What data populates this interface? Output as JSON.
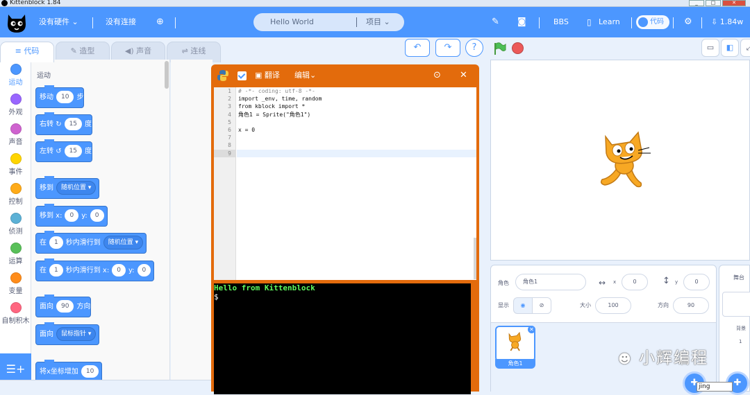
{
  "window": {
    "title": "Kittenblock 1.84"
  },
  "menubar": {
    "hardware": "没有硬件",
    "connection": "没有连接",
    "project_name": "Hello World",
    "project_menu": "项目",
    "bbs": "BBS",
    "learn": "Learn",
    "code_toggle": "代码",
    "version_badge": "1.84w"
  },
  "tabs": {
    "code": "代码",
    "costume": "造型",
    "sound": "声音",
    "connect": "连线"
  },
  "categories": [
    {
      "label": "运动",
      "color": "#4c97ff"
    },
    {
      "label": "外观",
      "color": "#9966ff"
    },
    {
      "label": "声音",
      "color": "#cf63cf"
    },
    {
      "label": "事件",
      "color": "#ffd500"
    },
    {
      "label": "控制",
      "color": "#ffab19"
    },
    {
      "label": "侦测",
      "color": "#5cb1d6"
    },
    {
      "label": "运算",
      "color": "#59c059"
    },
    {
      "label": "变量",
      "color": "#ff8c1a"
    },
    {
      "label": "自制积木",
      "color": "#ff6680"
    }
  ],
  "palette": {
    "title": "运动",
    "move": {
      "a": "移动",
      "n": "10",
      "b": "步"
    },
    "turn_right": {
      "a": "右转",
      "n": "15",
      "b": "度"
    },
    "turn_left": {
      "a": "左转",
      "n": "15",
      "b": "度"
    },
    "goto": {
      "a": "移到",
      "menu": "随机位置"
    },
    "goto_xy": {
      "a": "移到 x:",
      "x": "0",
      "b": "y:",
      "y": "0"
    },
    "glide": {
      "a": "在",
      "n": "1",
      "b": "秒内滑行到",
      "menu": "随机位置"
    },
    "glide_xy": {
      "a": "在",
      "n": "1",
      "b": "秒内滑行到 x:",
      "x": "0",
      "c": "y:",
      "y": "0"
    },
    "point_dir": {
      "a": "面向",
      "n": "90",
      "b": "方向"
    },
    "point_towards": {
      "a": "面向",
      "menu": "鼠标指针"
    },
    "change_x": {
      "a": "将x坐标增加",
      "n": "10"
    }
  },
  "editor": {
    "translate": "翻译",
    "edit": "编辑",
    "line_numbers": [
      "1",
      "2",
      "3",
      "4",
      "5",
      "6",
      "7",
      "8",
      "9"
    ],
    "code_lines": [
      "# -*- coding: utf-8 -*-",
      "import _env, time, random",
      "from kblock import *",
      "角色1 = Sprite(\"角色1\")",
      "",
      "x = 0",
      "",
      "",
      ""
    ],
    "terminal": {
      "line1": "Hello from Kittenblock",
      "line2": "$"
    }
  },
  "sprite_panel": {
    "sprite_label": "角色",
    "sprite_name": "角色1",
    "x_label": "x",
    "x_value": "0",
    "y_label": "y",
    "y_value": "0",
    "show_label": "显示",
    "size_label": "大小",
    "size_value": "100",
    "direction_label": "方向",
    "direction_value": "90",
    "thumb_name": "角色1"
  },
  "backdrop_panel": {
    "title": "舞台",
    "backdrop_label": "背景",
    "backdrop_count": "1"
  },
  "watermark": "小辉编程",
  "popup": "jing"
}
